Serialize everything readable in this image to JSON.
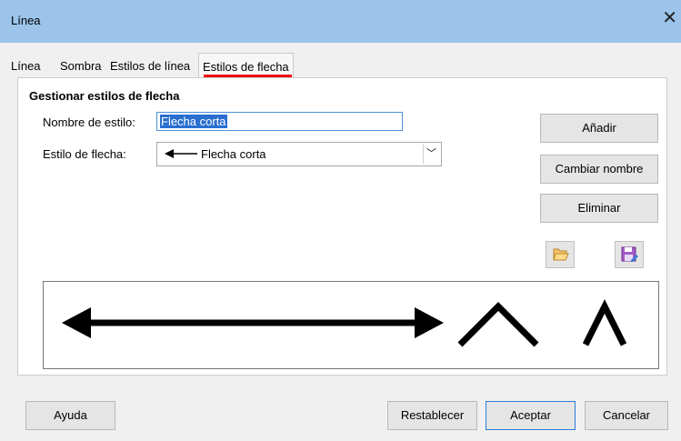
{
  "window": {
    "title": "Línea"
  },
  "tabs": [
    {
      "label": "Línea"
    },
    {
      "label": "Sombra"
    },
    {
      "label": "Estilos de línea"
    },
    {
      "label": "Estilos de flecha"
    }
  ],
  "section": {
    "heading": "Gestionar estilos de flecha"
  },
  "form": {
    "style_name_label": "Nombre de estilo:",
    "style_name_value": "Flecha corta",
    "arrow_style_label": "Estilo de flecha:",
    "arrow_style_value": "Flecha corta"
  },
  "side_buttons": {
    "add": "Añadir",
    "rename": "Cambiar nombre",
    "delete": "Eliminar"
  },
  "footer": {
    "help": "Ayuda",
    "reset": "Restablecer",
    "ok": "Aceptar",
    "cancel": "Cancelar"
  },
  "icons": {
    "open": "folder-open-icon",
    "save": "save-icon"
  }
}
